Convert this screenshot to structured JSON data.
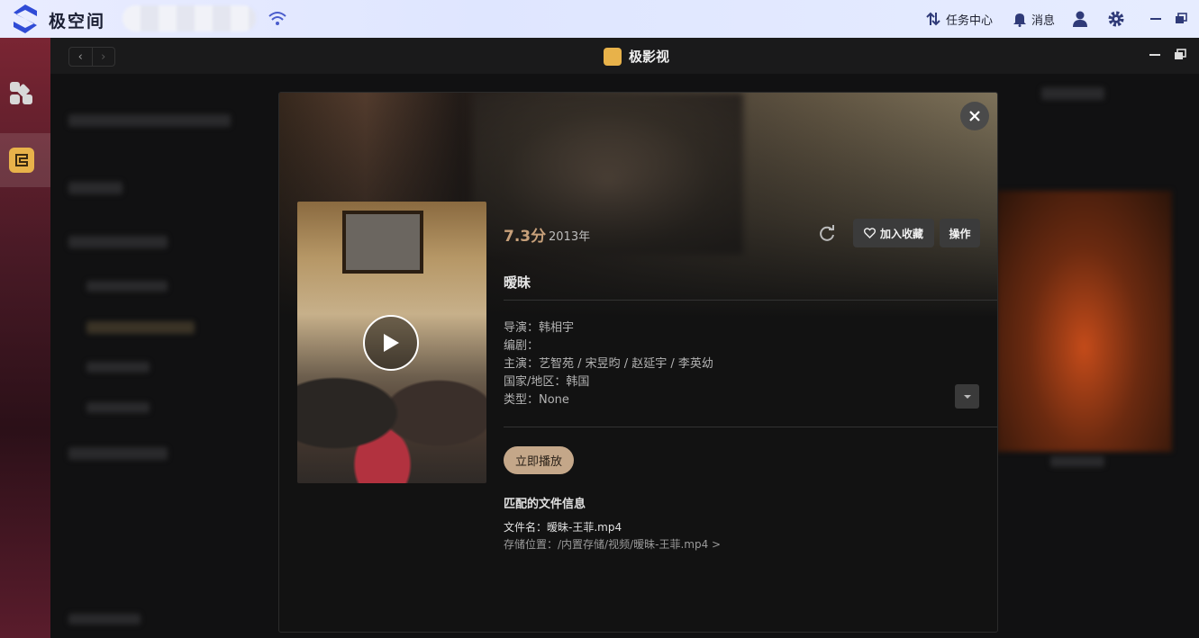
{
  "system": {
    "brand_name": "极空间",
    "task_center_label": "任务中心",
    "messages_label": "消息",
    "accent_color": "#2f4bd6"
  },
  "sidebar": {
    "items": [
      {
        "icon": "apps-grid-icon"
      },
      {
        "icon": "jiyingshi-app-icon"
      }
    ]
  },
  "window": {
    "title": "极影视",
    "nav": {
      "back": "‹",
      "forward": "›"
    }
  },
  "detail": {
    "rating": "7.3分",
    "year": "2013年",
    "favorite_label": "加入收藏",
    "operate_label": "操作",
    "title": "暧昧",
    "meta": {
      "director": "导演：韩相宇",
      "writer": "编剧：",
      "cast": "主演：艺智苑 / 宋昱昀 / 赵延宇 / 李英幼",
      "region": "国家/地区：韩国",
      "genre": "类型：None"
    },
    "play_now_label": "立即播放",
    "file_section_title": "匹配的文件信息",
    "file_name": "文件名：暧昧-王菲.mp4",
    "file_path": "存储位置：/内置存储/视频/暧昧-王菲.mp4 >",
    "accent_color": "#c7a07a"
  }
}
